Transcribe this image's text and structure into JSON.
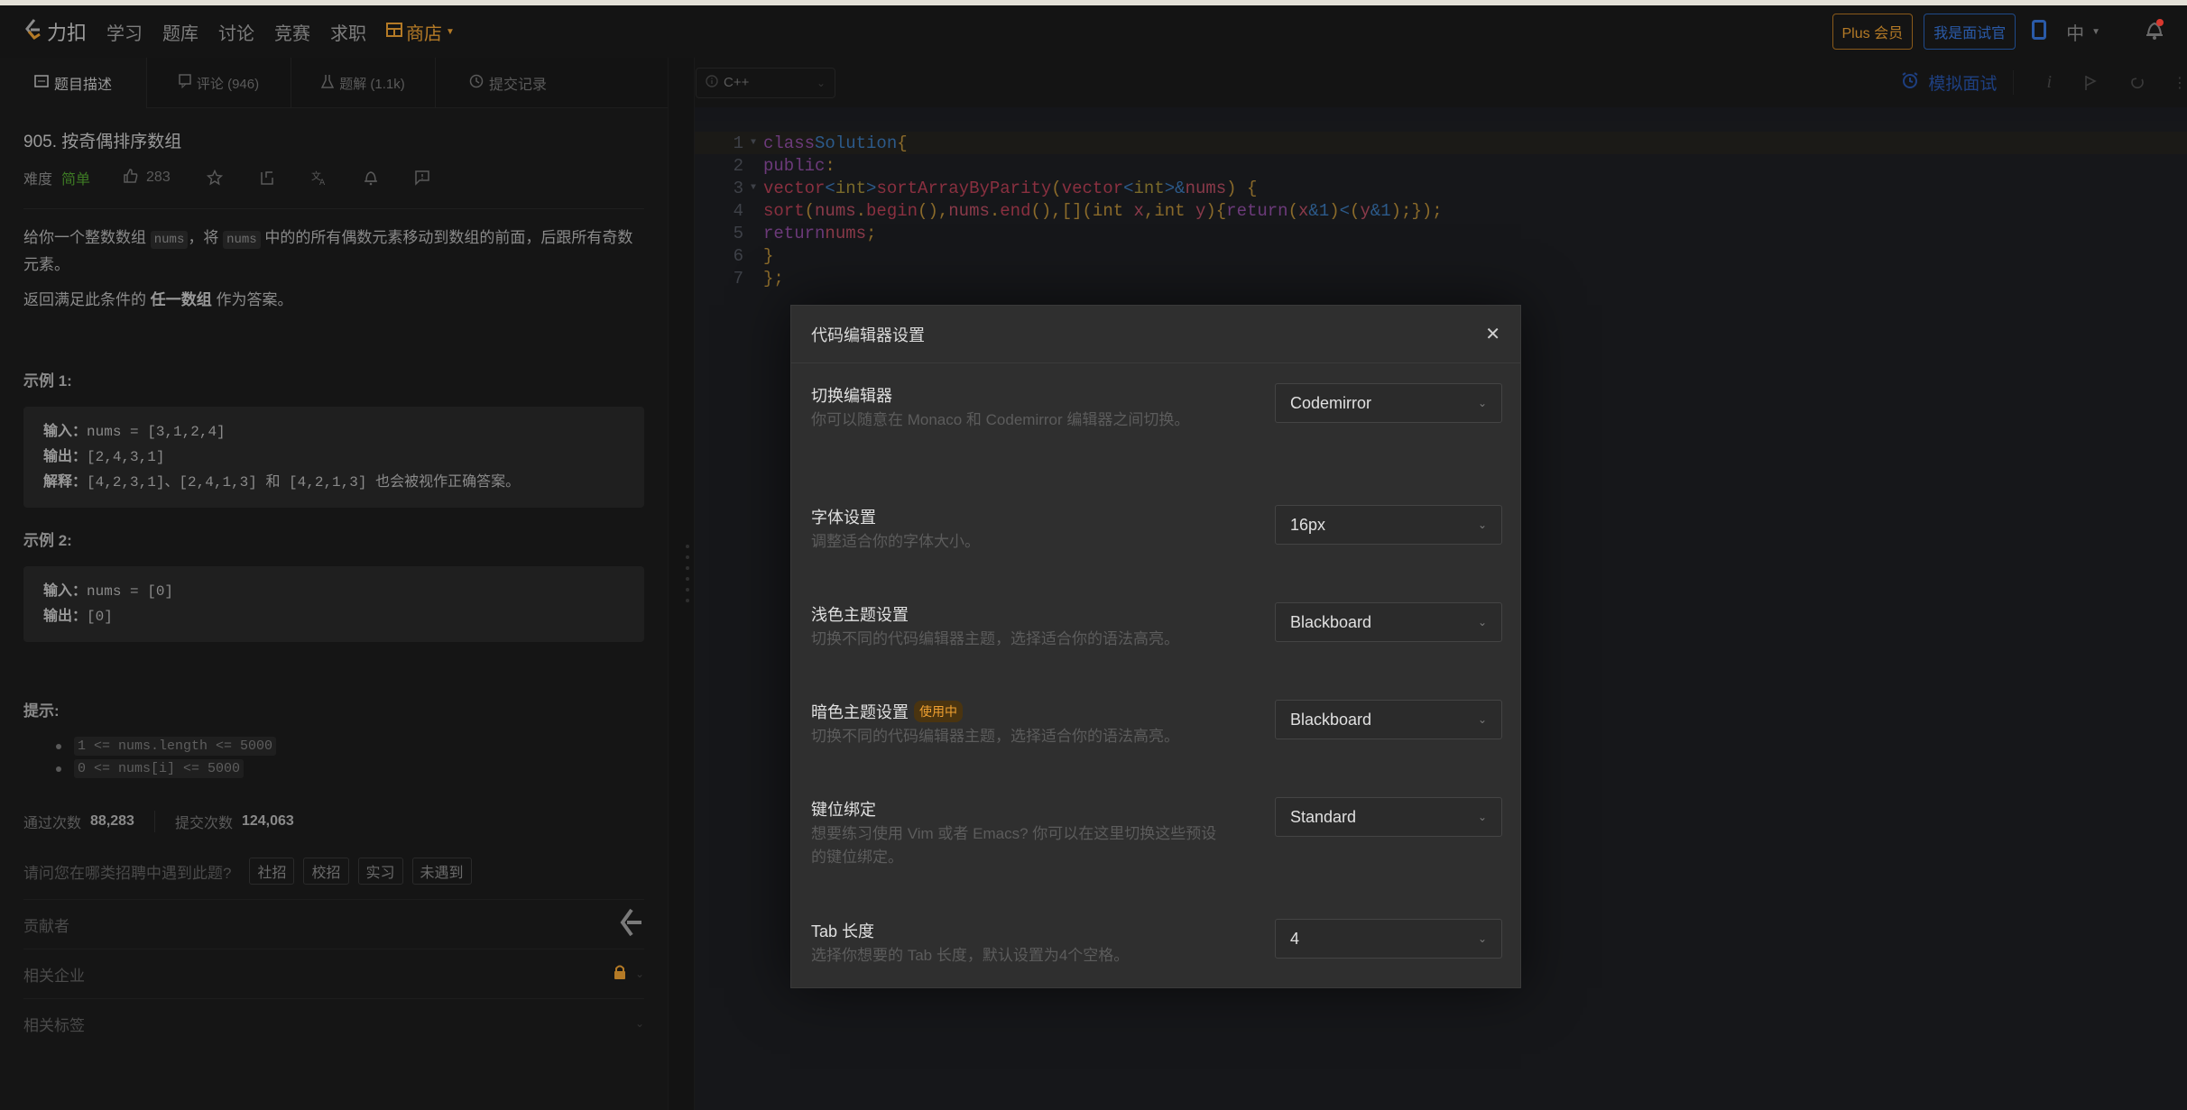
{
  "navbar": {
    "logo_text": "力扣",
    "links": [
      "学习",
      "题库",
      "讨论",
      "竞赛",
      "求职"
    ],
    "store_label": "商店",
    "plus_label": "Plus 会员",
    "interviewer_label": "我是面试官",
    "lang_label": "中",
    "colors": {
      "brand": "#b47a26",
      "interviewer": "#2a5aa8",
      "notification_dot": "#d9382e"
    }
  },
  "left_tabs": [
    {
      "label": "题目描述",
      "icon": "description-icon"
    },
    {
      "label": "评论 (946)",
      "icon": "comment-icon"
    },
    {
      "label": "题解 (1.1k)",
      "icon": "flask-icon"
    },
    {
      "label": "提交记录",
      "icon": "clock-icon"
    }
  ],
  "problem": {
    "title": "905. 按奇偶排序数组",
    "difficulty_label": "难度",
    "difficulty": "简单",
    "likes": "283",
    "desc_p1_a": "给你一个整数数组 ",
    "desc_code1": "nums",
    "desc_p1_b": "，将 ",
    "desc_code2": "nums",
    "desc_p1_c": " 中的的所有偶数元素移动到数组的前面，后跟所有奇数元素。",
    "desc_p2_a": "返回满足此条件的 ",
    "desc_p2_bold": "任一数组",
    "desc_p2_b": " 作为答案。",
    "example1_title": "示例 1:",
    "example1": {
      "input_label": "输入：",
      "input": "nums = [3,1,2,4]",
      "output_label": "输出：",
      "output": "[2,4,3,1]",
      "explain_label": "解释：",
      "explain": "[4,2,3,1]、[2,4,1,3] 和 [4,2,1,3] 也会被视作正确答案。"
    },
    "example2_title": "示例 2:",
    "example2": {
      "input_label": "输入：",
      "input": "nums = [0]",
      "output_label": "输出：",
      "output": "[0]"
    },
    "hints_title": "提示:",
    "hints": [
      "1 <= nums.length <= 5000",
      "0 <= nums[i] <= 5000"
    ],
    "accepted_label": "通过次数",
    "accepted": "88,283",
    "submissions_label": "提交次数",
    "submissions": "124,063",
    "recruit_question": "请问您在哪类招聘中遇到此题?",
    "recruit_options": [
      "社招",
      "校招",
      "实习",
      "未遇到"
    ],
    "contributors_label": "贡献者",
    "companies_label": "相关企业",
    "tags_label": "相关标签"
  },
  "editor": {
    "language": "C++",
    "mock_interview_label": "模拟面试",
    "lines": [
      "1",
      "2",
      "3",
      "4",
      "5",
      "6",
      "7"
    ]
  },
  "modal": {
    "title": "代码编辑器设置",
    "settings": [
      {
        "label": "切换编辑器",
        "desc": "你可以随意在 Monaco 和 Codemirror 编辑器之间切换。",
        "value": "Codemirror"
      },
      {
        "label": "字体设置",
        "desc": "调整适合你的字体大小。",
        "value": "16px"
      },
      {
        "label": "浅色主题设置",
        "desc": "切换不同的代码编辑器主题，选择适合你的语法高亮。",
        "value": "Blackboard"
      },
      {
        "label": "暗色主题设置",
        "badge": "使用中",
        "desc": "切换不同的代码编辑器主题，选择适合你的语法高亮。",
        "value": "Blackboard"
      },
      {
        "label": "键位绑定",
        "desc": "想要练习使用 Vim 或者 Emacs? 你可以在这里切换这些预设的键位绑定。",
        "value": "Standard"
      },
      {
        "label": "Tab 长度",
        "desc": "选择你想要的 Tab 长度，默认设置为4个空格。",
        "value": "4"
      }
    ]
  }
}
